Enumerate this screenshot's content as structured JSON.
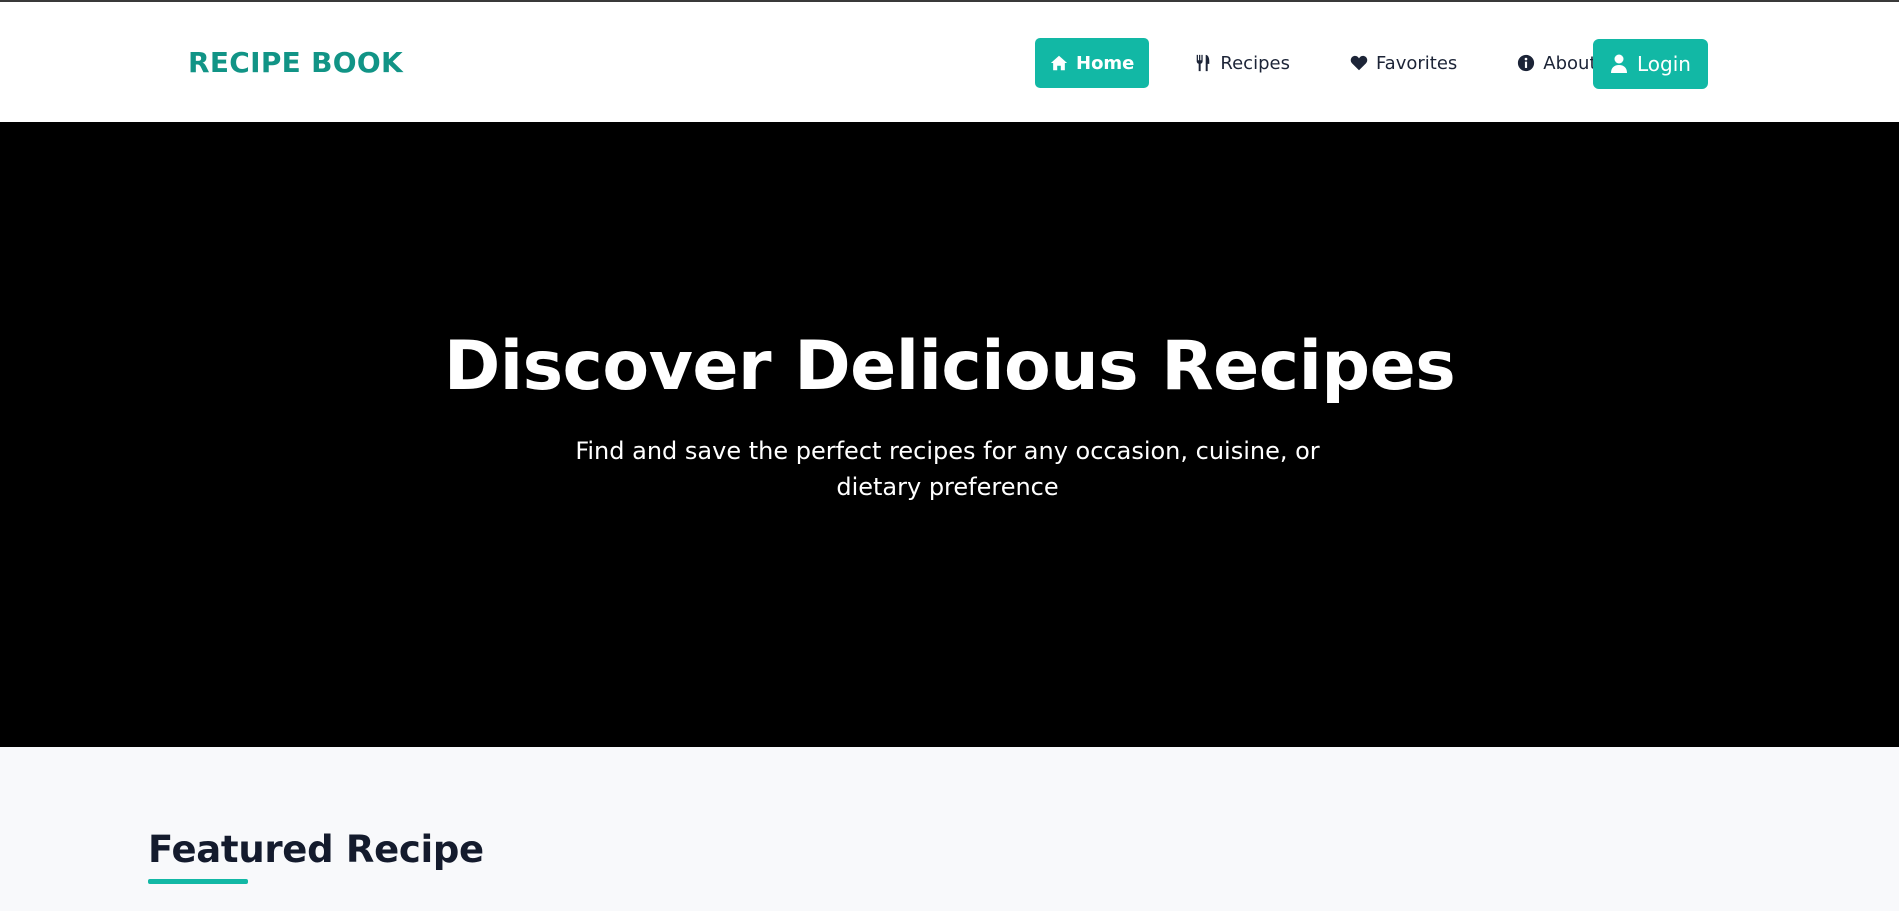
{
  "brand": "RECIPE BOOK",
  "nav": {
    "items": [
      {
        "label": "Home",
        "icon": "home-icon",
        "active": true
      },
      {
        "label": "Recipes",
        "icon": "utensils-icon",
        "active": false
      },
      {
        "label": "Favorites",
        "icon": "heart-icon",
        "active": false
      },
      {
        "label": "About",
        "icon": "info-icon",
        "active": false
      }
    ],
    "login_label": "Login",
    "login_icon": "user-icon"
  },
  "hero": {
    "title": "Discover Delicious Recipes",
    "subtitle": "Find and save the perfect recipes for any occasion, cuisine, or dietary preference"
  },
  "featured": {
    "heading": "Featured Recipe"
  },
  "colors": {
    "accent": "#12b8a5",
    "brand": "#119486",
    "hero_bg": "#000000",
    "text_dark": "#141b2d"
  }
}
